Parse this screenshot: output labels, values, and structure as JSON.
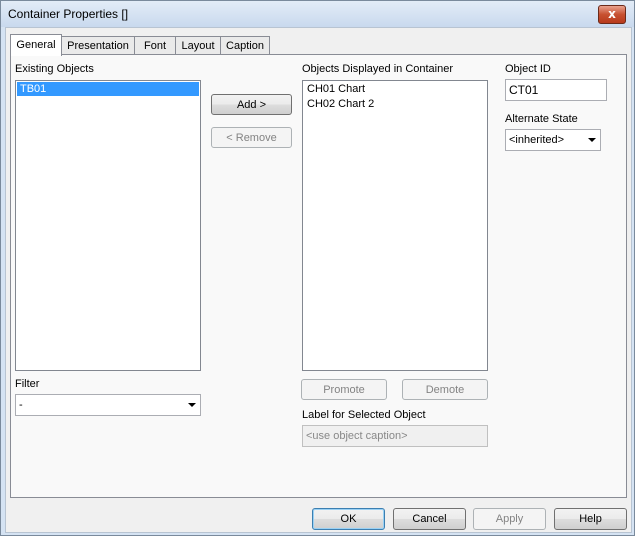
{
  "window": {
    "title": "Container Properties []",
    "close_glyph": "x"
  },
  "tabs": [
    {
      "label": "General",
      "active": true
    },
    {
      "label": "Presentation",
      "active": false
    },
    {
      "label": "Font",
      "active": false
    },
    {
      "label": "Layout",
      "active": false
    },
    {
      "label": "Caption",
      "active": false
    }
  ],
  "existing": {
    "label": "Existing Objects",
    "items": [
      "TB01"
    ],
    "selected_index": 0
  },
  "buttons": {
    "add": "Add >",
    "remove": "< Remove",
    "promote": "Promote",
    "demote": "Demote",
    "ok": "OK",
    "cancel": "Cancel",
    "apply": "Apply",
    "help": "Help"
  },
  "displayed": {
    "label": "Objects Displayed in Container",
    "items": [
      "CH01 Chart",
      "CH02 Chart 2"
    ]
  },
  "object_id": {
    "label": "Object ID",
    "value": "CT01"
  },
  "alternate_state": {
    "label": "Alternate State",
    "value": "<inherited>"
  },
  "filter": {
    "label": "Filter",
    "value": "-"
  },
  "selected_label": {
    "label": "Label for Selected Object",
    "placeholder": "<use object caption>"
  },
  "colors": {
    "selection": "#3399ff",
    "titlebar": "#d5e3f3",
    "close": "#c75030"
  }
}
